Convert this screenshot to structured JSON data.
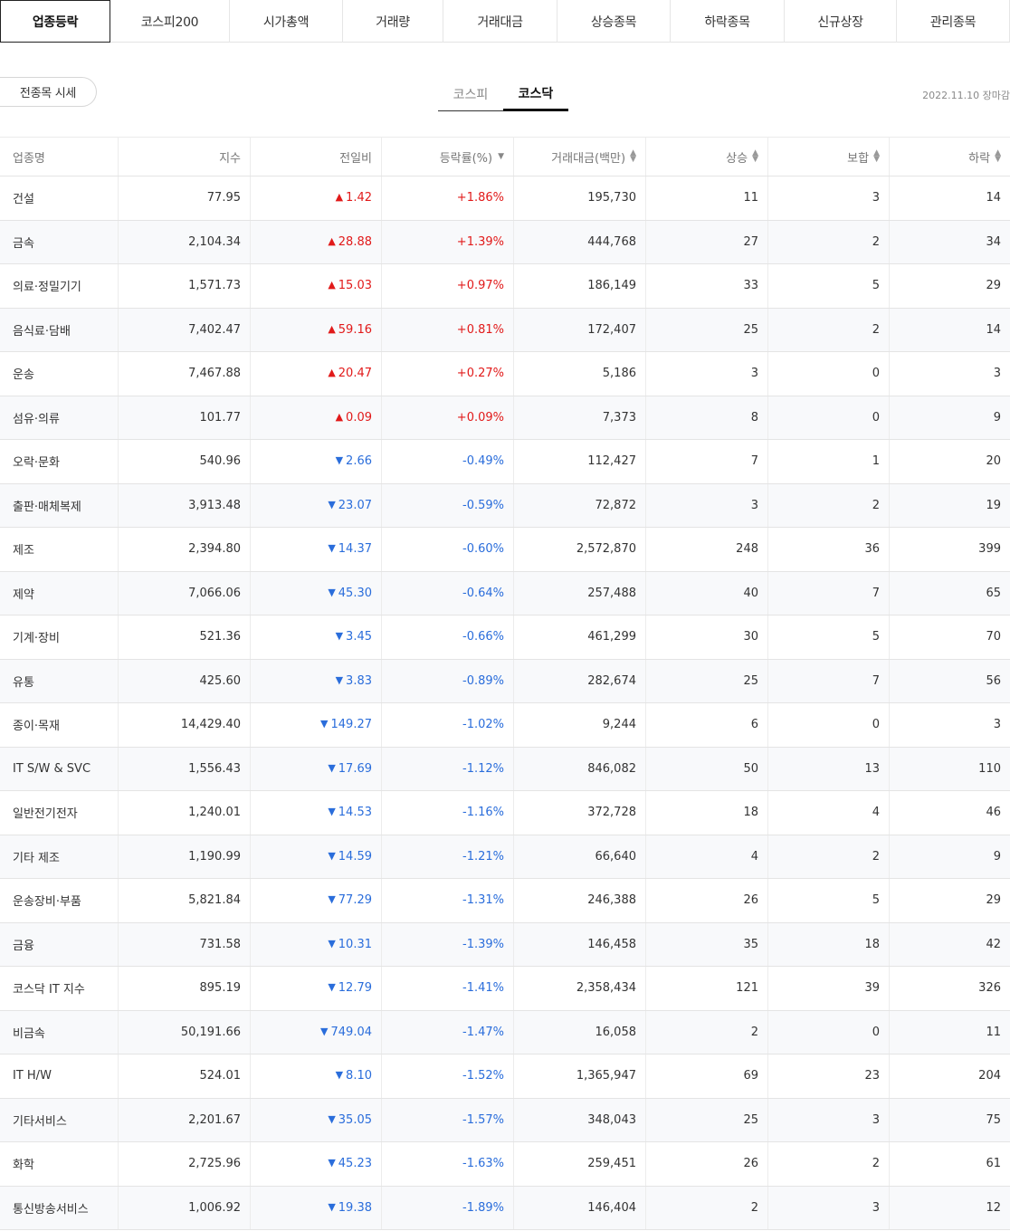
{
  "top_tabs": [
    "업종등락",
    "코스피200",
    "시가총액",
    "거래량",
    "거래대금",
    "상승종목",
    "하락종목",
    "신규상장",
    "관리종목"
  ],
  "all_button": "전종목 시세",
  "sub_tabs": [
    "코스피",
    "코스닥"
  ],
  "date_text": "2022.11.10 장마감",
  "headers": [
    "업종명",
    "지수",
    "전일비",
    "등락률(%)",
    "거래대금(백만)",
    "상승",
    "보합",
    "하락"
  ],
  "icons": {
    "up": "▲",
    "down": "▼",
    "sort_both": "▲▼",
    "sort_desc": "▼"
  },
  "colors": {
    "up": "#e11a1a",
    "down": "#2a6ddb"
  },
  "rows": [
    {
      "name": "건설",
      "index": "77.95",
      "dir": "up",
      "change": "1.42",
      "rate": "+1.86%",
      "amount": "195,730",
      "rise": "11",
      "flat": "3",
      "fall": "14"
    },
    {
      "name": "금속",
      "index": "2,104.34",
      "dir": "up",
      "change": "28.88",
      "rate": "+1.39%",
      "amount": "444,768",
      "rise": "27",
      "flat": "2",
      "fall": "34"
    },
    {
      "name": "의료·정밀기기",
      "index": "1,571.73",
      "dir": "up",
      "change": "15.03",
      "rate": "+0.97%",
      "amount": "186,149",
      "rise": "33",
      "flat": "5",
      "fall": "29"
    },
    {
      "name": "음식료·담배",
      "index": "7,402.47",
      "dir": "up",
      "change": "59.16",
      "rate": "+0.81%",
      "amount": "172,407",
      "rise": "25",
      "flat": "2",
      "fall": "14"
    },
    {
      "name": "운송",
      "index": "7,467.88",
      "dir": "up",
      "change": "20.47",
      "rate": "+0.27%",
      "amount": "5,186",
      "rise": "3",
      "flat": "0",
      "fall": "3"
    },
    {
      "name": "섬유·의류",
      "index": "101.77",
      "dir": "up",
      "change": "0.09",
      "rate": "+0.09%",
      "amount": "7,373",
      "rise": "8",
      "flat": "0",
      "fall": "9"
    },
    {
      "name": "오락·문화",
      "index": "540.96",
      "dir": "down",
      "change": "2.66",
      "rate": "-0.49%",
      "amount": "112,427",
      "rise": "7",
      "flat": "1",
      "fall": "20"
    },
    {
      "name": "출판·매체복제",
      "index": "3,913.48",
      "dir": "down",
      "change": "23.07",
      "rate": "-0.59%",
      "amount": "72,872",
      "rise": "3",
      "flat": "2",
      "fall": "19"
    },
    {
      "name": "제조",
      "index": "2,394.80",
      "dir": "down",
      "change": "14.37",
      "rate": "-0.60%",
      "amount": "2,572,870",
      "rise": "248",
      "flat": "36",
      "fall": "399"
    },
    {
      "name": "제약",
      "index": "7,066.06",
      "dir": "down",
      "change": "45.30",
      "rate": "-0.64%",
      "amount": "257,488",
      "rise": "40",
      "flat": "7",
      "fall": "65"
    },
    {
      "name": "기계·장비",
      "index": "521.36",
      "dir": "down",
      "change": "3.45",
      "rate": "-0.66%",
      "amount": "461,299",
      "rise": "30",
      "flat": "5",
      "fall": "70"
    },
    {
      "name": "유통",
      "index": "425.60",
      "dir": "down",
      "change": "3.83",
      "rate": "-0.89%",
      "amount": "282,674",
      "rise": "25",
      "flat": "7",
      "fall": "56"
    },
    {
      "name": "종이·목재",
      "index": "14,429.40",
      "dir": "down",
      "change": "149.27",
      "rate": "-1.02%",
      "amount": "9,244",
      "rise": "6",
      "flat": "0",
      "fall": "3"
    },
    {
      "name": "IT S/W & SVC",
      "index": "1,556.43",
      "dir": "down",
      "change": "17.69",
      "rate": "-1.12%",
      "amount": "846,082",
      "rise": "50",
      "flat": "13",
      "fall": "110"
    },
    {
      "name": "일반전기전자",
      "index": "1,240.01",
      "dir": "down",
      "change": "14.53",
      "rate": "-1.16%",
      "amount": "372,728",
      "rise": "18",
      "flat": "4",
      "fall": "46"
    },
    {
      "name": "기타 제조",
      "index": "1,190.99",
      "dir": "down",
      "change": "14.59",
      "rate": "-1.21%",
      "amount": "66,640",
      "rise": "4",
      "flat": "2",
      "fall": "9"
    },
    {
      "name": "운송장비·부품",
      "index": "5,821.84",
      "dir": "down",
      "change": "77.29",
      "rate": "-1.31%",
      "amount": "246,388",
      "rise": "26",
      "flat": "5",
      "fall": "29"
    },
    {
      "name": "금융",
      "index": "731.58",
      "dir": "down",
      "change": "10.31",
      "rate": "-1.39%",
      "amount": "146,458",
      "rise": "35",
      "flat": "18",
      "fall": "42"
    },
    {
      "name": "코스닥 IT 지수",
      "index": "895.19",
      "dir": "down",
      "change": "12.79",
      "rate": "-1.41%",
      "amount": "2,358,434",
      "rise": "121",
      "flat": "39",
      "fall": "326"
    },
    {
      "name": "비금속",
      "index": "50,191.66",
      "dir": "down",
      "change": "749.04",
      "rate": "-1.47%",
      "amount": "16,058",
      "rise": "2",
      "flat": "0",
      "fall": "11"
    },
    {
      "name": "IT H/W",
      "index": "524.01",
      "dir": "down",
      "change": "8.10",
      "rate": "-1.52%",
      "amount": "1,365,947",
      "rise": "69",
      "flat": "23",
      "fall": "204"
    },
    {
      "name": "기타서비스",
      "index": "2,201.67",
      "dir": "down",
      "change": "35.05",
      "rate": "-1.57%",
      "amount": "348,043",
      "rise": "25",
      "flat": "3",
      "fall": "75"
    },
    {
      "name": "화학",
      "index": "2,725.96",
      "dir": "down",
      "change": "45.23",
      "rate": "-1.63%",
      "amount": "259,451",
      "rise": "26",
      "flat": "2",
      "fall": "61"
    },
    {
      "name": "통신방송서비스",
      "index": "1,006.92",
      "dir": "down",
      "change": "19.38",
      "rate": "-1.89%",
      "amount": "146,404",
      "rise": "2",
      "flat": "3",
      "fall": "12"
    }
  ]
}
